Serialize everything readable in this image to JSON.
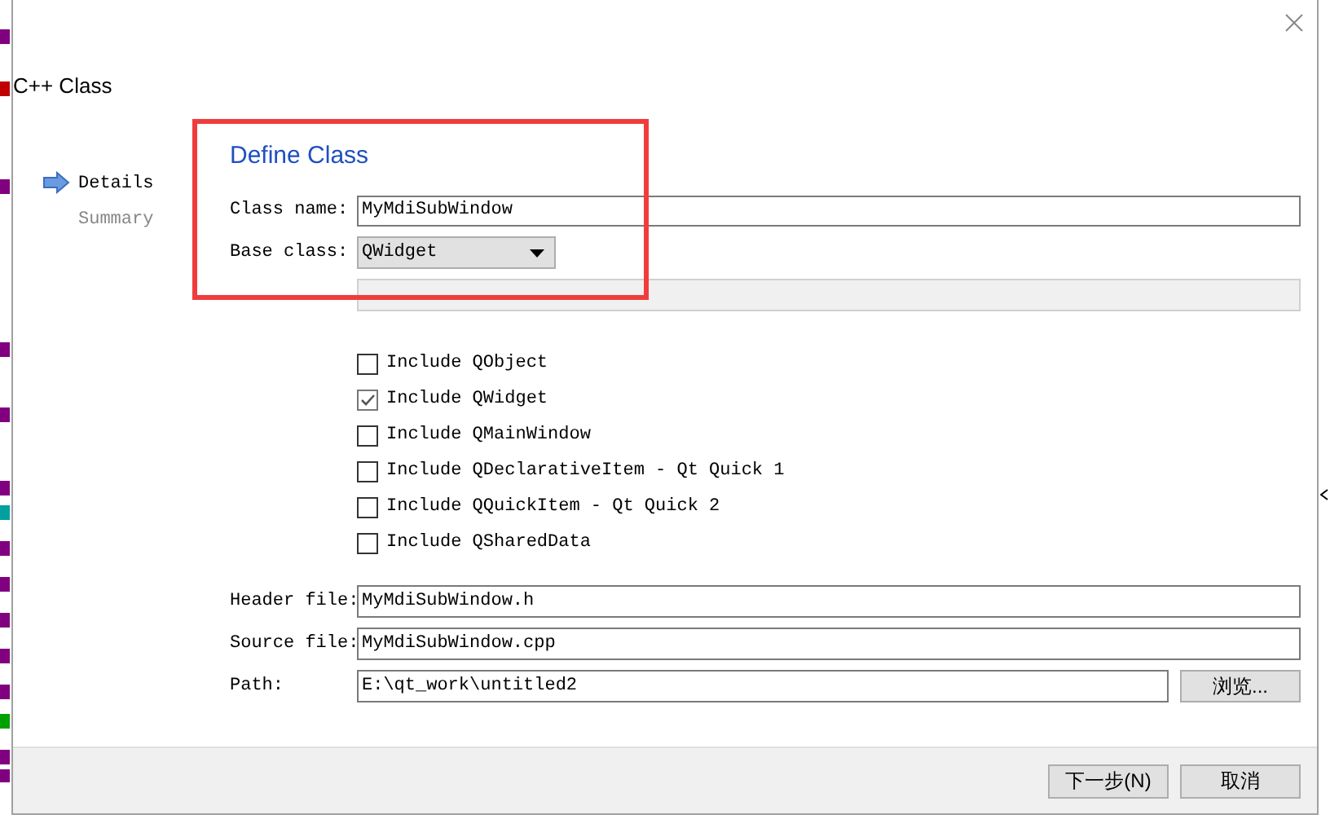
{
  "window": {
    "title": "C++ Class"
  },
  "steps": [
    {
      "label": "Details",
      "selected": true
    },
    {
      "label": "Summary",
      "selected": false
    }
  ],
  "page_title": "Define Class",
  "class_name": {
    "label": "Class name:",
    "value": "MyMdiSubWindow"
  },
  "base_class": {
    "label": "Base class:",
    "value": "QWidget"
  },
  "progress": {
    "level": 0
  },
  "includes": [
    {
      "label": "Include QObject",
      "checked": false
    },
    {
      "label": "Include QWidget",
      "checked": true
    },
    {
      "label": "Include QMainWindow",
      "checked": false
    },
    {
      "label": "Include QDeclarativeItem - Qt Quick 1",
      "checked": false
    },
    {
      "label": "Include QQuickItem - Qt Quick 2",
      "checked": false
    },
    {
      "label": "Include QSharedData",
      "checked": false
    }
  ],
  "files": [
    {
      "label": "Header file:",
      "value": "MyMdiSubWindow.h"
    },
    {
      "label": "Source file:",
      "value": "MyMdiSubWindow.cpp"
    },
    {
      "label": "Path:",
      "value": "E:\\qt_work\\untitled2",
      "button": "浏览..."
    }
  ],
  "buttons": [
    {
      "label": "下一步(N)"
    },
    {
      "label": "取消"
    }
  ]
}
